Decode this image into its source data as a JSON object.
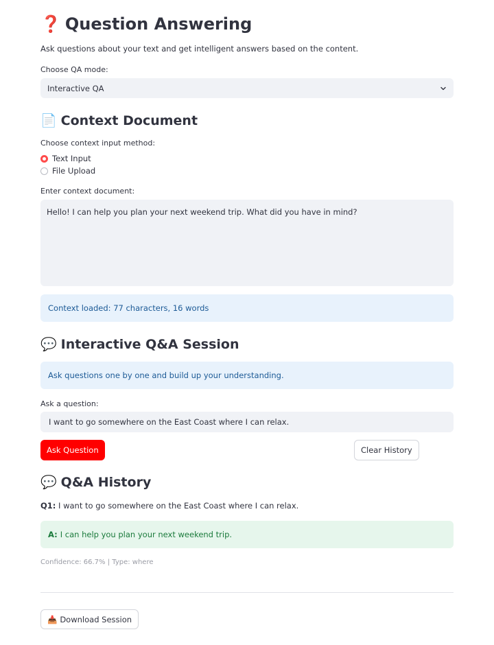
{
  "header": {
    "title_icon": "❓",
    "title": "Question Answering",
    "description": "Ask questions about your text and get intelligent answers based on the content."
  },
  "qa_mode": {
    "label": "Choose QA mode:",
    "selected": "Interactive QA"
  },
  "context": {
    "heading_icon": "📄",
    "heading": "Context Document",
    "method_label": "Choose context input method:",
    "options": [
      "Text Input",
      "File Upload"
    ],
    "selected_option": "Text Input",
    "document_label": "Enter context document:",
    "document_value": "Hello! I can help you plan your next weekend trip. What did you have in mind?",
    "loaded_info": "Context loaded: 77 characters, 16 words"
  },
  "session": {
    "heading_icon": "💬",
    "heading": "Interactive Q&A Session",
    "info": "Ask questions one by one and build up your understanding.",
    "question_label": "Ask a question:",
    "question_value": "I want to go somewhere on the East Coast where I can relax.",
    "ask_button": "Ask Question",
    "clear_button": "Clear History"
  },
  "history": {
    "heading_icon": "💬",
    "heading": "Q&A History",
    "items": [
      {
        "q_prefix": "Q1:",
        "question": "I want to go somewhere on the East Coast where I can relax.",
        "a_prefix": "A:",
        "answer": "I can help you plan your next weekend trip.",
        "meta": "Confidence: 66.7% | Type: where"
      }
    ]
  },
  "download": {
    "icon": "📥",
    "label": "Download Session"
  },
  "colors": {
    "accent": "#ff0000",
    "radio_accent": "#ff4b4b",
    "info_bg": "#e8f2fc",
    "info_text": "#1c5a96",
    "success_bg": "#e6f6ec",
    "success_text": "#1a7a3b"
  }
}
